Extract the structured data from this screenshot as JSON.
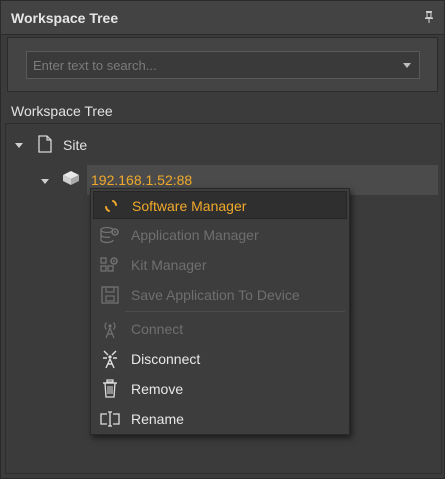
{
  "panel": {
    "title": "Workspace Tree",
    "pin_icon": "pin-icon"
  },
  "search": {
    "placeholder": "Enter text to search...",
    "value": ""
  },
  "tree": {
    "header": "Workspace Tree",
    "root": {
      "label": "Site",
      "icon": "document-icon",
      "expanded": true
    },
    "device": {
      "label": "192.168.1.52:88",
      "icon": "device-icon",
      "expanded": true,
      "label_color": "#f0a92b"
    }
  },
  "context_menu": {
    "items": [
      {
        "label": "Software Manager",
        "icon": "loading-icon",
        "state": "highlight"
      },
      {
        "label": "Application Manager",
        "icon": "database-gear-icon",
        "state": "disabled"
      },
      {
        "label": "Kit Manager",
        "icon": "grid-gear-icon",
        "state": "disabled"
      },
      {
        "label": "Save Application To Device",
        "icon": "save-icon",
        "state": "disabled"
      },
      {
        "label": "Connect",
        "icon": "antenna-icon",
        "state": "disabled"
      },
      {
        "label": "Disconnect",
        "icon": "disconnect-antenna-icon",
        "state": "enabled"
      },
      {
        "label": "Remove",
        "icon": "trash-icon",
        "state": "enabled"
      },
      {
        "label": "Rename",
        "icon": "rename-icon",
        "state": "enabled"
      }
    ]
  },
  "colors": {
    "accent": "#f0a92b",
    "background": "#3b3b3b",
    "disabled_text": "#6f6f6f"
  }
}
